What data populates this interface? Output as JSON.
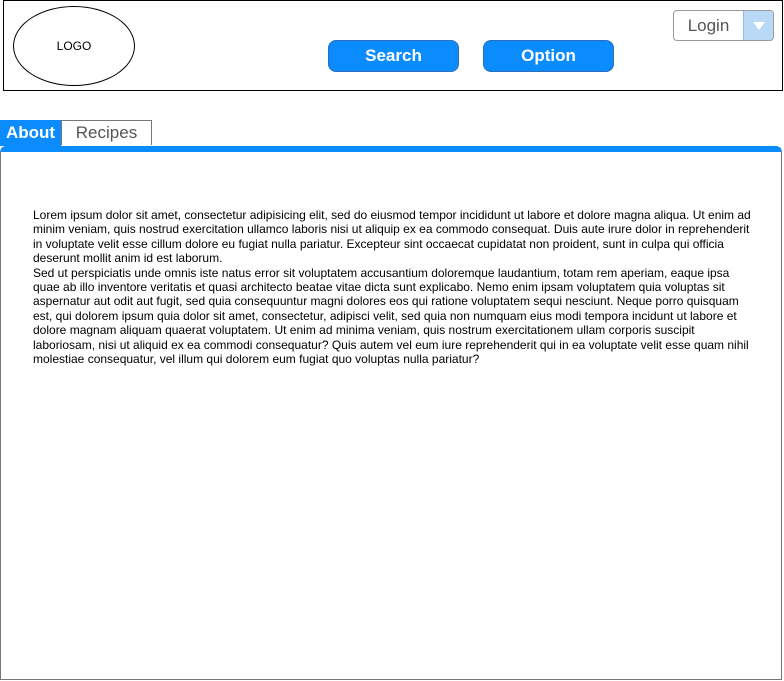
{
  "header": {
    "logo_text": "LOGO",
    "search_label": "Search",
    "option_label": "Option",
    "login_label": "Login"
  },
  "tabs": [
    {
      "label": "About",
      "active": true
    },
    {
      "label": "Recipes",
      "active": false
    }
  ],
  "content": {
    "paragraph1": "Lorem ipsum dolor sit amet, consectetur adipisicing elit, sed do eiusmod tempor incididunt ut labore et dolore magna aliqua. Ut enim ad minim veniam, quis nostrud exercitation ullamco laboris nisi ut aliquip ex ea commodo consequat. Duis aute irure dolor in reprehenderit in voluptate velit esse cillum dolore eu fugiat nulla pariatur. Excepteur sint occaecat cupidatat non proident, sunt in culpa qui officia deserunt mollit anim id est laborum.",
    "paragraph2": "Sed ut perspiciatis unde omnis iste natus error sit voluptatem accusantium doloremque laudantium, totam rem aperiam, eaque ipsa quae ab illo inventore veritatis et quasi architecto beatae vitae dicta sunt explicabo. Nemo enim ipsam voluptatem quia voluptas sit aspernatur aut odit aut fugit, sed quia consequuntur magni dolores eos qui ratione voluptatem sequi nesciunt. Neque porro quisquam est, qui dolorem ipsum quia dolor sit amet, consectetur, adipisci velit, sed quia non numquam eius modi tempora incidunt ut labore et dolore magnam aliquam quaerat voluptatem. Ut enim ad minima veniam, quis nostrum exercitationem ullam corporis suscipit laboriosam, nisi ut aliquid ex ea commodi consequatur? Quis autem vel eum iure reprehenderit qui in ea voluptate velit esse quam nihil molestiae consequatur, vel illum qui dolorem eum fugiat quo voluptas nulla pariatur?"
  },
  "colors": {
    "accent": "#0a8cff",
    "dropdown_arrow_bg": "#b9d9f7"
  },
  "icons": {
    "login_dropdown": "chevron-down-icon"
  }
}
